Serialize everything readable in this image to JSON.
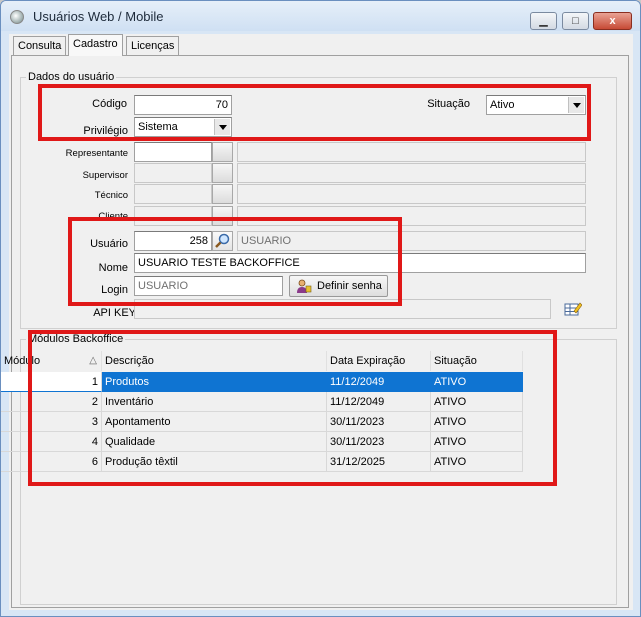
{
  "window": {
    "title": "Usuários Web / Mobile",
    "min_label": "▁",
    "max_label": "□",
    "close_label": "x"
  },
  "tabs": [
    "Consulta",
    "Cadastro",
    "Licenças"
  ],
  "user_group": {
    "title": "Dados do usuário",
    "codigo_label": "Código",
    "codigo_value": "70",
    "situacao_label": "Situação",
    "situacao_value": "Ativo",
    "privilegio_label": "Privilégio",
    "privilegio_value": "Sistema",
    "representante_label": "Representante",
    "supervisor_label": "Supervisor",
    "tecnico_label": "Técnico",
    "cliente_label": "Cliente",
    "usuario_label": "Usuário",
    "usuario_value": "258",
    "usuario_desc": "USUARIO",
    "nome_label": "Nome",
    "nome_value": "USUARIO TESTE BACKOFFICE",
    "login_label": "Login",
    "login_value": "USUARIO",
    "definir_senha_label": "Definir senha",
    "api_key_label": "API KEY"
  },
  "modules_group": {
    "title": "Módulos Backoffice",
    "columns": [
      "Módulo",
      "Descrição",
      "Data Expiração",
      "Situação"
    ],
    "sort_indicator": "△",
    "rows": [
      [
        "1",
        "Produtos",
        "11/12/2049",
        "ATIVO"
      ],
      [
        "2",
        "Inventário",
        "11/12/2049",
        "ATIVO"
      ],
      [
        "3",
        "Apontamento",
        "30/11/2023",
        "ATIVO"
      ],
      [
        "4",
        "Qualidade",
        "30/11/2023",
        "ATIVO"
      ],
      [
        "6",
        "Produção têxtil",
        "31/12/2025",
        "ATIVO"
      ]
    ]
  },
  "colors": {
    "highlight_box": "#e01818",
    "selection": "#0f74d2"
  }
}
